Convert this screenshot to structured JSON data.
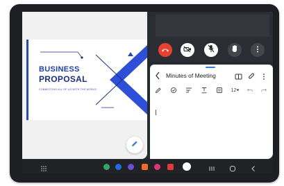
{
  "slide": {
    "title_line1": "BUSINESS",
    "title_line2": "PROPOSAL",
    "tagline": "CONNECTING ALL OF US WITH THE WORLD",
    "accent_color": "#2847c7"
  },
  "call": {
    "buttons": [
      "hangup-icon",
      "video-off-icon",
      "mic-off-icon",
      "raise-hand-icon",
      "more-vert-icon"
    ],
    "hangup_color": "#e8412f"
  },
  "notes": {
    "title": "Minutes of Meeting",
    "font_size": "12",
    "toolbar": [
      "pen-icon",
      "checkbox-icon",
      "text-format-icon",
      "text-underline-icon",
      "insert-icon",
      "font-size",
      "undo-icon",
      "redo-icon"
    ]
  },
  "taskbar": {
    "apps": [
      {
        "name": "phone-app-icon",
        "color": "#2ea866"
      },
      {
        "name": "messages-app-icon",
        "color": "#1e6de0"
      },
      {
        "name": "internet-app-icon",
        "color": "#6a4fd6"
      },
      {
        "name": "slides-app-icon",
        "color": "#f06a2a"
      },
      {
        "name": "gallery-app-icon",
        "color": "#e0337a"
      },
      {
        "name": "video-app-icon",
        "color": "#e33b3b"
      },
      {
        "name": "meet-app-icon",
        "color": "#ffffff"
      }
    ]
  }
}
